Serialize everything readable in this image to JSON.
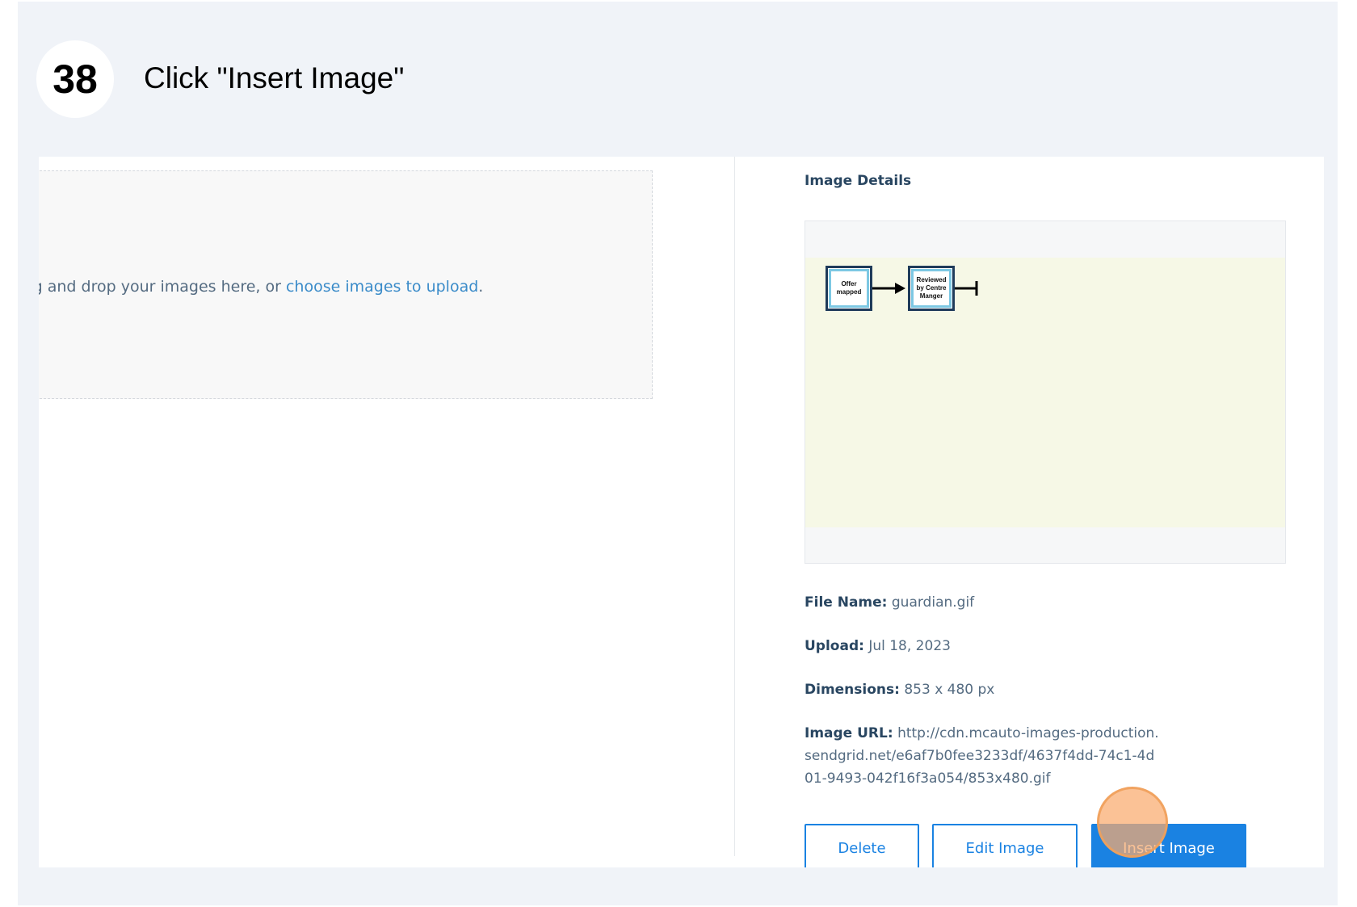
{
  "step": {
    "number": "38",
    "instruction": "Click \"Insert Image\""
  },
  "upload": {
    "text_prefix": "ag and drop your images here, or ",
    "link_text": "choose images to upload",
    "text_suffix": "."
  },
  "details": {
    "title": "Image Details",
    "preview": {
      "nodes": [
        "Offer mapped",
        "Reviewed by Centre Manger"
      ]
    },
    "file_name_label": "File Name:",
    "file_name": "guardian.gif",
    "upload_label": "Upload:",
    "upload_date": "Jul 18, 2023",
    "dimensions_label": "Dimensions:",
    "dimensions": "853 x 480 px",
    "url_label": "Image URL:",
    "url": "http://cdn.mcauto-images-production.sendgrid.net/e6af7b0fee3233df/4637f4dd-74c1-4d01-9493-042f16f3a054/853x480.gif"
  },
  "buttons": {
    "delete": "Delete",
    "edit": "Edit Image",
    "insert": "Insert Image"
  },
  "colors": {
    "accent": "#1a82e2",
    "text_dark": "#294661",
    "text_muted": "#546b81",
    "click_indicator": "#f5a86a"
  }
}
